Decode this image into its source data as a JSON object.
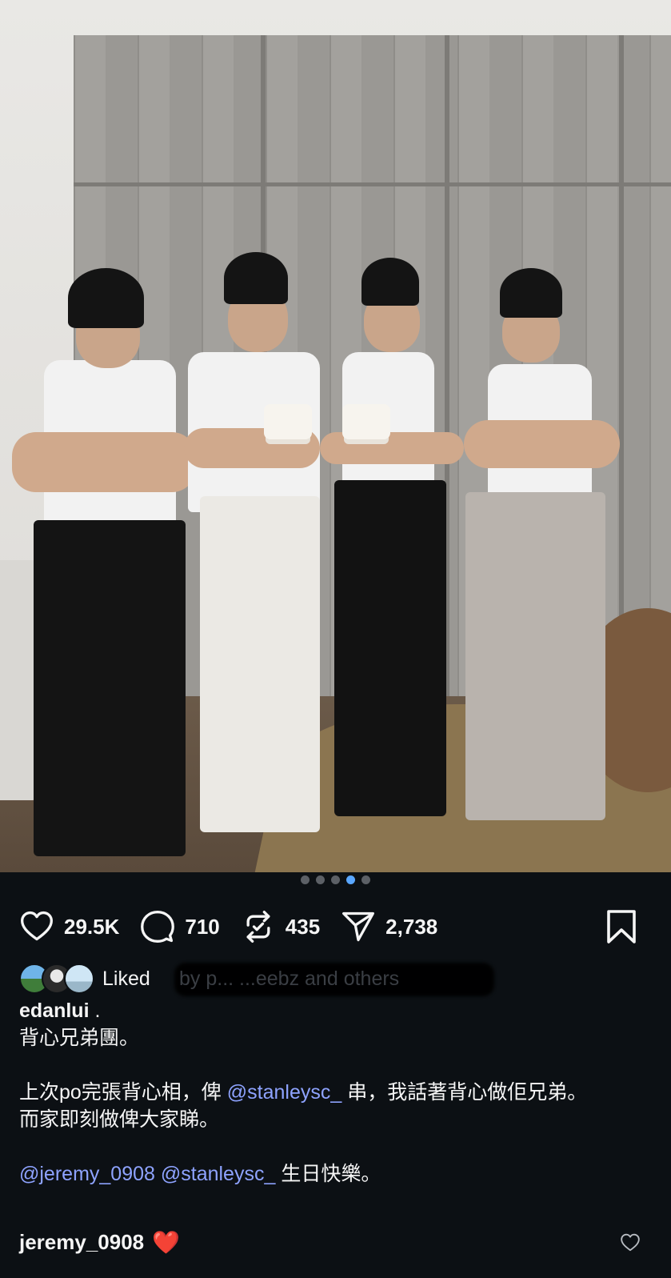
{
  "post": {
    "image_alt": "Four people in white tank tops and black caps holding birthday cakes",
    "carousel": {
      "count": 5,
      "active_index": 3
    }
  },
  "actions": {
    "likes": "29.5K",
    "comments": "710",
    "reposts": "435",
    "shares": "2,738"
  },
  "liked_by": {
    "prefix": "Liked",
    "hidden_text": "by p...  ...eebz and others"
  },
  "caption": {
    "username": "edanlui",
    "username_suffix": " .",
    "line1": "背心兄弟團。",
    "line3_a": "上次po完張背心相，俾 ",
    "line3_mention": "@stanleysc_",
    "line3_b": " 串，我話著背心做佢兄弟。",
    "line4": "而家即刻做俾大家睇。",
    "line6_mention1": "@jeremy_0908",
    "line6_mention2": "@stanleysc_",
    "line6_b": " 生日快樂。"
  },
  "comment": {
    "username": "jeremy_0908",
    "emoji": "❤️"
  },
  "colors": {
    "background": "#0c1014",
    "mention": "#8ea3ff",
    "active_dot": "#5aa7ff"
  }
}
